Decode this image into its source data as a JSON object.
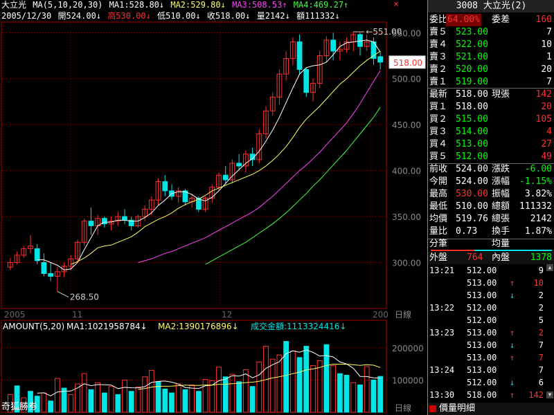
{
  "header": {
    "line1": {
      "name": "大立光",
      "ma_label": "MA(5,10,20,30)",
      "ma1": "MA1:528.80↓",
      "ma2": "MA2:529.80↓",
      "ma3": "MA3:508.53↑",
      "ma4": "MA4:469.27↑"
    },
    "line2": {
      "date": "2005/12/30",
      "open": "開524.00↓",
      "high": "高530.00↓",
      "low": "低510.00↓",
      "close": "收518.00↓",
      "vol": "量2142↓",
      "amt": "額111332↓"
    },
    "close_btn": "×"
  },
  "colors": {
    "up": "#ff3030",
    "down": "#00e5e5",
    "ma1": "#ffffff",
    "ma2": "#ffff66",
    "ma3": "#ff40ff",
    "ma4": "#40ff40",
    "grid": "#a00000"
  },
  "chart_data": [
    {
      "type": "candlestick",
      "y_ticks": [
        "550.00",
        "500.00",
        "450.00",
        "400.00",
        "350.00",
        "300.00"
      ],
      "ylim": [
        250,
        560
      ],
      "x_labels": [
        "2005",
        "11",
        "12",
        "200"
      ],
      "max_label": "551.00",
      "min_label": "268.50",
      "last_price": "518.00",
      "period_label": "日線",
      "candles": [
        [
          295,
          305,
          292,
          300
        ],
        [
          300,
          312,
          298,
          308
        ],
        [
          308,
          318,
          305,
          315
        ],
        [
          315,
          330,
          310,
          318
        ],
        [
          315,
          320,
          298,
          302
        ],
        [
          300,
          310,
          285,
          288
        ],
        [
          288,
          300,
          280,
          285
        ],
        [
          285,
          295,
          268.5,
          290
        ],
        [
          290,
          300,
          284,
          296
        ],
        [
          296,
          308,
          292,
          304
        ],
        [
          304,
          325,
          300,
          322
        ],
        [
          322,
          348,
          318,
          345
        ],
        [
          345,
          360,
          330,
          340
        ],
        [
          340,
          352,
          330,
          348
        ],
        [
          348,
          350,
          338,
          342
        ],
        [
          342,
          350,
          335,
          345
        ],
        [
          345,
          355,
          340,
          350
        ],
        [
          350,
          358,
          342,
          346
        ],
        [
          346,
          350,
          335,
          340
        ],
        [
          340,
          352,
          338,
          350
        ],
        [
          350,
          362,
          345,
          358
        ],
        [
          358,
          372,
          352,
          368
        ],
        [
          368,
          392,
          362,
          388
        ],
        [
          388,
          395,
          372,
          378
        ],
        [
          378,
          385,
          368,
          372
        ],
        [
          372,
          382,
          365,
          378
        ],
        [
          378,
          380,
          362,
          366
        ],
        [
          366,
          375,
          360,
          370
        ],
        [
          370,
          372,
          355,
          358
        ],
        [
          358,
          372,
          355,
          370
        ],
        [
          370,
          385,
          365,
          382
        ],
        [
          382,
          398,
          378,
          395
        ],
        [
          395,
          405,
          385,
          390
        ],
        [
          390,
          412,
          386,
          408
        ],
        [
          408,
          418,
          400,
          405
        ],
        [
          405,
          422,
          398,
          418
        ],
        [
          418,
          425,
          405,
          412
        ],
        [
          412,
          445,
          408,
          440
        ],
        [
          440,
          470,
          435,
          465
        ],
        [
          465,
          485,
          460,
          480
        ],
        [
          480,
          510,
          472,
          505
        ],
        [
          505,
          530,
          498,
          522
        ],
        [
          522,
          545,
          515,
          540
        ],
        [
          540,
          548,
          505,
          510
        ],
        [
          510,
          512,
          480,
          485
        ],
        [
          485,
          500,
          475,
          495
        ],
        [
          495,
          530,
          490,
          525
        ],
        [
          525,
          546,
          518,
          542
        ],
        [
          542,
          550,
          520,
          530
        ],
        [
          530,
          540,
          520,
          532
        ],
        [
          532,
          545,
          528,
          540
        ],
        [
          540,
          551,
          530,
          548
        ],
        [
          548,
          550,
          525,
          535
        ],
        [
          535,
          548,
          530,
          540
        ],
        [
          540,
          545,
          515,
          522
        ],
        [
          524,
          530,
          510,
          518
        ]
      ],
      "ma_series": [
        {
          "name": "MA1",
          "values": [
            null,
            null,
            null,
            null,
            303,
            303,
            300,
            297,
            292,
            293,
            300,
            314,
            327,
            340,
            344,
            344,
            346,
            346,
            345,
            345,
            349,
            354,
            362,
            368,
            375,
            377,
            377,
            374,
            369,
            367,
            371,
            378,
            386,
            394,
            401,
            408,
            413,
            421,
            432,
            444,
            458,
            474,
            490,
            505,
            512,
            514,
            515,
            518,
            526,
            535,
            539,
            540,
            541,
            542,
            540,
            529
          ]
        },
        {
          "name": "MA2",
          "values": [
            null,
            null,
            null,
            null,
            null,
            null,
            null,
            null,
            null,
            298,
            301,
            305,
            310,
            316,
            318,
            319,
            322,
            325,
            328,
            333,
            339,
            343,
            347,
            350,
            354,
            359,
            363,
            366,
            369,
            373,
            378,
            381,
            384,
            387,
            390,
            393,
            396,
            400,
            405,
            411,
            418,
            426,
            436,
            447,
            456,
            463,
            470,
            478,
            486,
            494,
            500,
            507,
            514,
            520,
            525,
            530
          ]
        },
        {
          "name": "MA3",
          "values": [
            null,
            null,
            null,
            null,
            null,
            null,
            null,
            null,
            null,
            null,
            null,
            null,
            null,
            null,
            null,
            null,
            null,
            null,
            null,
            300,
            302,
            304,
            307,
            310,
            312,
            315,
            318,
            321,
            324,
            327,
            331,
            335,
            339,
            343,
            347,
            351,
            355,
            360,
            366,
            372,
            379,
            386,
            393,
            400,
            406,
            413,
            420,
            428,
            436,
            444,
            452,
            462,
            473,
            485,
            497,
            508.5
          ]
        },
        {
          "name": "MA4",
          "values": [
            null,
            null,
            null,
            null,
            null,
            null,
            null,
            null,
            null,
            null,
            null,
            null,
            null,
            null,
            null,
            null,
            null,
            null,
            null,
            null,
            null,
            null,
            null,
            null,
            null,
            null,
            null,
            null,
            null,
            298,
            302,
            306,
            310,
            314,
            318,
            322,
            327,
            332,
            337,
            342,
            348,
            354,
            361,
            368,
            375,
            383,
            390,
            398,
            406,
            414,
            422,
            431,
            440,
            449,
            458,
            469
          ]
        }
      ]
    },
    {
      "type": "bar",
      "title": "AMOUNT(5,20)",
      "ma1": "MA1:1021958784↓",
      "ma2": "MA2:1390176896↓",
      "amount_label": "成交金額:1113324416↓",
      "y_ticks": [
        "200000",
        "100000"
      ],
      "ylim": [
        0,
        260000
      ],
      "period_label": "日線",
      "values": [
        [
          55000,
          0
        ],
        [
          82000,
          1
        ],
        [
          45000,
          0
        ],
        [
          65000,
          1
        ],
        [
          50000,
          1
        ],
        [
          60000,
          0
        ],
        [
          35000,
          1
        ],
        [
          105000,
          0
        ],
        [
          75000,
          1
        ],
        [
          55000,
          0
        ],
        [
          88000,
          0
        ],
        [
          120000,
          0
        ],
        [
          70000,
          1
        ],
        [
          92000,
          0
        ],
        [
          60000,
          1
        ],
        [
          80000,
          0
        ],
        [
          55000,
          1
        ],
        [
          100000,
          0
        ],
        [
          65000,
          1
        ],
        [
          78000,
          0
        ],
        [
          110000,
          0
        ],
        [
          130000,
          0
        ],
        [
          95000,
          1
        ],
        [
          72000,
          1
        ],
        [
          60000,
          1
        ],
        [
          88000,
          0
        ],
        [
          70000,
          1
        ],
        [
          85000,
          0
        ],
        [
          65000,
          1
        ],
        [
          102000,
          0
        ],
        [
          98000,
          0
        ],
        [
          140000,
          0
        ],
        [
          110000,
          1
        ],
        [
          118000,
          0
        ],
        [
          95000,
          1
        ],
        [
          132000,
          0
        ],
        [
          80000,
          1
        ],
        [
          156000,
          0
        ],
        [
          205000,
          0
        ],
        [
          165000,
          0
        ],
        [
          178000,
          0
        ],
        [
          220000,
          1
        ],
        [
          190000,
          0
        ],
        [
          170000,
          1
        ],
        [
          205000,
          1
        ],
        [
          145000,
          0
        ],
        [
          160000,
          0
        ],
        [
          210000,
          1
        ],
        [
          145000,
          0
        ],
        [
          120000,
          1
        ],
        [
          115000,
          1
        ],
        [
          92000,
          0
        ],
        [
          85000,
          1
        ],
        [
          142000,
          0
        ],
        [
          100000,
          1
        ],
        [
          111332,
          1
        ]
      ],
      "ma_series": [
        {
          "name": "MA1",
          "values": [
            null,
            null,
            null,
            null,
            59400,
            60400,
            51000,
            63000,
            65000,
            66000,
            75600,
            88600,
            82600,
            86000,
            85400,
            84400,
            73400,
            77400,
            76000,
            75600,
            79600,
            92600,
            95800,
            97000,
            93400,
            87400,
            77000,
            75000,
            73600,
            82000,
            84000,
            98000,
            103000,
            113600,
            112200,
            119000,
            107000,
            116200,
            136400,
            147600,
            156800,
            181600,
            190800,
            186600,
            193600,
            186000,
            174400,
            176000,
            172000,
            156000,
            150000,
            136400,
            111400,
            110800,
            106800,
            106200
          ]
        },
        {
          "name": "MA2",
          "values": [
            null,
            null,
            null,
            null,
            null,
            null,
            null,
            null,
            null,
            null,
            null,
            null,
            null,
            null,
            null,
            null,
            null,
            null,
            null,
            70850,
            73600,
            77850,
            80350,
            80700,
            81200,
            82600,
            84350,
            83200,
            83450,
            84650,
            84250,
            86750,
            87300,
            88650,
            90100,
            92100,
            93400,
            96300,
            101300,
            106600,
            110000,
            114500,
            119800,
            124700,
            131700,
            134600,
            139100,
            145400,
            149300,
            149200,
            149300,
            147300,
            145500,
            147700,
            146100,
            139017
          ]
        }
      ]
    }
  ],
  "panel": {
    "title": "3008 大立光(2)",
    "row_wb": {
      "label": "委比",
      "value": "64.00%",
      "label2": "委差",
      "value2": "160"
    },
    "sells": [
      {
        "label": "賣５",
        "price": "523.00",
        "qty": "7"
      },
      {
        "label": "賣４",
        "price": "522.00",
        "qty": "10"
      },
      {
        "label": "賣３",
        "price": "521.00",
        "qty": "1"
      },
      {
        "label": "賣２",
        "price": "520.00",
        "qty": "20"
      },
      {
        "label": "賣１",
        "price": "519.00",
        "qty": "7"
      }
    ],
    "latest": {
      "label": "最新",
      "price": "518.00",
      "label2": "現張",
      "qty": "142"
    },
    "buys": [
      {
        "label": "買１",
        "price": "518.00",
        "qty": "20"
      },
      {
        "label": "買２",
        "price": "515.00",
        "qty": "105"
      },
      {
        "label": "買３",
        "price": "514.00",
        "qty": "4"
      },
      {
        "label": "買４",
        "price": "513.00",
        "qty": "27"
      },
      {
        "label": "買５",
        "price": "512.00",
        "qty": "49"
      }
    ],
    "stats": [
      {
        "l1": "前收",
        "v1": "524.00",
        "l2": "漲跌",
        "v2": "-6.00",
        "c1": "#ffffff",
        "c2": "#00ff00"
      },
      {
        "l1": "今開",
        "v1": "524.00",
        "l2": "漲幅",
        "v2": "-1.15%",
        "c1": "#ffffff",
        "c2": "#00ff00"
      },
      {
        "l1": "最高",
        "v1": "530.00",
        "l2": "振幅",
        "v2": "3.82%",
        "c1": "#ff3030",
        "c2": "#ffffff"
      },
      {
        "l1": "最低",
        "v1": "510.00",
        "l2": "總額",
        "v2": "111332",
        "c1": "#ffffff",
        "c2": "#ffffff"
      },
      {
        "l1": "均價",
        "v1": "519.76",
        "l2": "總張",
        "v2": "2142",
        "c1": "#ffffff",
        "c2": "#ffffff"
      },
      {
        "l1": "量比",
        "v1": "0.73",
        "l2": "換手",
        "v2": "1.87%",
        "c1": "#ffffff",
        "c2": "#ffffff"
      }
    ],
    "fenbi": {
      "label": "分筆",
      "label2": "均量"
    },
    "inout": {
      "out_label": "外盤",
      "out_val": "764",
      "in_label": "內盤",
      "in_val": "1378"
    },
    "ticks": [
      {
        "time": "13:21",
        "price": "512.00",
        "arrow": "",
        "qty": "9",
        "qc": "#ffffff"
      },
      {
        "time": "",
        "price": "513.00",
        "arrow": "↑",
        "qty": "10",
        "qc": "#ff3030"
      },
      {
        "time": "",
        "price": "513.00",
        "arrow": "↓",
        "qty": "2",
        "qc": "#ffffff"
      },
      {
        "time": "13:22",
        "price": "512.00",
        "arrow": "",
        "qty": "2",
        "qc": "#ffffff"
      },
      {
        "time": "",
        "price": "512.00",
        "arrow": "",
        "qty": "5",
        "qc": "#ffffff"
      },
      {
        "time": "13:23",
        "price": "513.00",
        "arrow": "↑",
        "qty": "2",
        "qc": "#ff3030"
      },
      {
        "time": "",
        "price": "513.00",
        "arrow": "↓",
        "qty": "7",
        "qc": "#ffffff"
      },
      {
        "time": "",
        "price": "513.00",
        "arrow": "↑",
        "qty": "7",
        "qc": "#ff3030"
      },
      {
        "time": "13:24",
        "price": "513.00",
        "arrow": "",
        "qty": "7",
        "qc": "#ffffff"
      },
      {
        "time": "",
        "price": "512.00",
        "arrow": "↓",
        "qty": "6",
        "qc": "#ffffff"
      },
      {
        "time": "13:30",
        "price": "518.00",
        "arrow": "↑",
        "qty": "142",
        "qc": "#ff3030"
      }
    ],
    "footer": "價量明細"
  },
  "bottom": {
    "label": "奇狐勝券"
  }
}
